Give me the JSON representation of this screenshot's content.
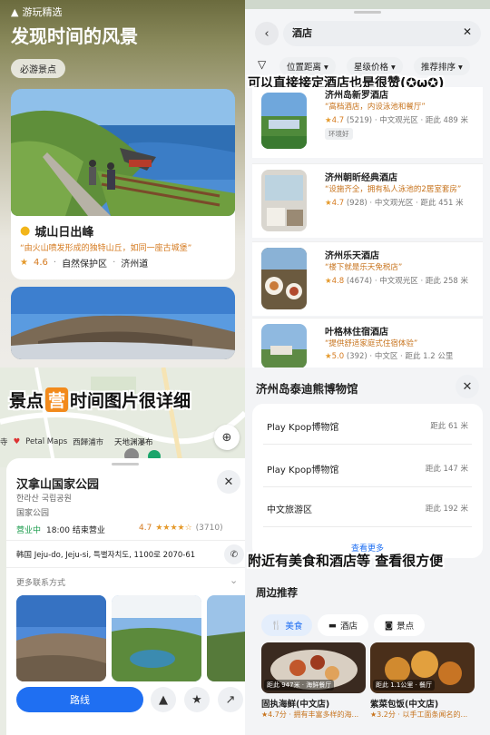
{
  "q1": {
    "header_label": "游玩精选",
    "title": "发现时间的风景",
    "chip": "必游景点",
    "card": {
      "name": "城山日出峰",
      "desc": "“由火山喷发形成的独特山丘，如同一座古城堡”",
      "rating": "4.6",
      "type": "自然保护区",
      "region": "济州道"
    }
  },
  "q2": {
    "search_value": "酒店",
    "filters": [
      "位置距离",
      "星级价格",
      "推荐排序"
    ],
    "overlay": "可以直接接定酒店也是很赞(✪ω✪)",
    "hotels": [
      {
        "name": "济州岛新罗酒店",
        "quote": "“高档酒店，内设泳池和餐厅”",
        "rating": "4.7",
        "count": "(5219)",
        "area": "中文观光区",
        "dist": "距此 489 米",
        "tag": "环境好"
      },
      {
        "name": "济州朝昕经典酒店",
        "quote": "“设施齐全，拥有私人泳池的2居室套房”",
        "rating": "4.7",
        "count": "(928)",
        "area": "中文观光区",
        "dist": "距此 451 米",
        "tag": ""
      },
      {
        "name": "济州乐天酒店",
        "quote": "“楼下就是乐天免税店”",
        "rating": "4.8",
        "count": "(4674)",
        "area": "中文观光区",
        "dist": "距此 258 米",
        "tag": ""
      },
      {
        "name": "叶格林住宿酒店",
        "quote": "“提供舒适家庭式住宿体验”",
        "rating": "5.0",
        "count": "(392)",
        "area": "中文区",
        "dist": "距此 1.2 公里",
        "tag": ""
      }
    ]
  },
  "q3": {
    "overlay_left": "景点",
    "overlay_badge": "营",
    "overlay_right": "时间图片很详细",
    "map_labels": {
      "petal": "Petal Maps",
      "l1": "西歸浦市",
      "l2": "天地渊瀑布"
    },
    "place": {
      "name": "汉拿山国家公园",
      "korean": "한라산 국립공원",
      "type": "国家公园",
      "status": "营业中",
      "hours": "18:00 结束营业",
      "rating": "4.7",
      "stars": "★★★★☆",
      "count": "(3710)",
      "address": "韩国 Jeju-do, Jeju-si, 특별자치도, 1100로 2070-61",
      "more": "更多联系方式"
    },
    "route_button": "路线"
  },
  "q4": {
    "title": "济州岛泰迪熊博物馆",
    "items": [
      {
        "name": "Play Kpop博物馆",
        "dist": "距此 61 米"
      },
      {
        "name": "Play Kpop博物馆",
        "dist": "距此 147 米"
      },
      {
        "name": "中文旅游区",
        "dist": "距此 192 米"
      }
    ],
    "see_more": "查看更多",
    "overlay": "附近有美食和酒店等 查看很方便",
    "section": "周边推荐",
    "tabs": [
      "美食",
      "酒店",
      "景点"
    ],
    "foods": [
      {
        "name": "固执海鲜(中文店)",
        "meta": "★4.7分 · 拥有丰富多样的海...",
        "badge": "距此 947米 · 海鲜餐厅"
      },
      {
        "name": "紫菜包饭(中文店)",
        "meta": "★3.2分 · 以手工面条闻名的...",
        "badge": "距此 1.1公里 · 餐厅"
      }
    ]
  }
}
